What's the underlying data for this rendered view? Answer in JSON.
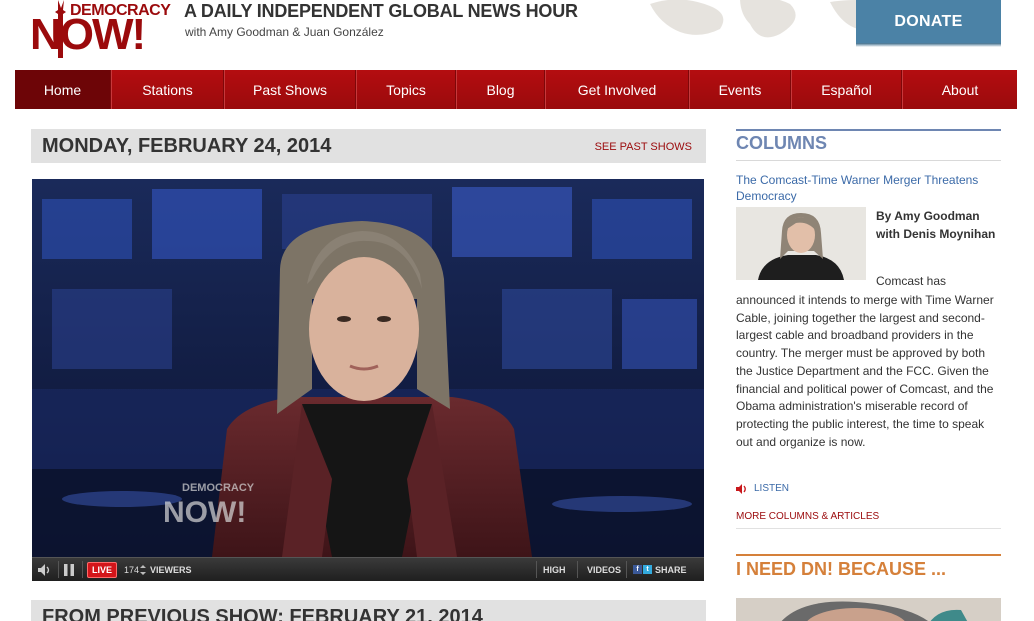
{
  "header": {
    "logo_top": "DEMOCRACY",
    "logo_bottom": "NOW!",
    "tagline": "A DAILY INDEPENDENT GLOBAL NEWS HOUR",
    "hosts": "with Amy Goodman & Juan González",
    "donate_label": "DONATE"
  },
  "nav": {
    "items": [
      {
        "label": "Home",
        "active": true
      },
      {
        "label": "Stations"
      },
      {
        "label": "Past Shows"
      },
      {
        "label": "Topics"
      },
      {
        "label": "Blog"
      },
      {
        "label": "Get Involved"
      },
      {
        "label": "Events"
      },
      {
        "label": "Español"
      },
      {
        "label": "About"
      }
    ]
  },
  "main": {
    "date_title": "MONDAY, FEBRUARY 24, 2014",
    "see_past_shows": "SEE PAST SHOWS",
    "prev_title": "FROM PREVIOUS SHOW: FEBRUARY 21, 2014"
  },
  "video": {
    "watermark_top": "DEMOCRACY",
    "watermark_bottom": "NOW!",
    "controls": {
      "live": "LIVE",
      "viewer_count": "174",
      "viewers_label": "VIEWERS",
      "high": "HIGH",
      "videos": "VIDEOS",
      "share": "SHARE",
      "facebook_glyph": "f",
      "twitter_glyph": "t"
    }
  },
  "sidebar": {
    "columns_title": "COLUMNS",
    "article_title": "The Comcast-Time Warner Merger Threatens Democracy",
    "byline": "By Amy Goodman with Denis Moynihan",
    "teaser_first": "Comcast has",
    "teaser_rest": "announced it intends to merge with Time Warner Cable, joining together the largest and second-largest cable and broadband providers in the country. The merger must be approved by both the Justice Department and the FCC. Given the financial and political power of Comcast, and the Obama administration's miserable record of protecting the public interest, the time to speak out and organize is now.",
    "listen_label": "LISTEN",
    "more_link": "MORE COLUMNS & ARTICLES",
    "need_title": "I NEED DN! BECAUSE ..."
  },
  "colors": {
    "brand_red": "#9b0a0c",
    "nav_red": "#b40d10",
    "donate_blue": "#4b82a6",
    "columns_blue": "#6e86b2",
    "need_orange": "#d5803a"
  }
}
